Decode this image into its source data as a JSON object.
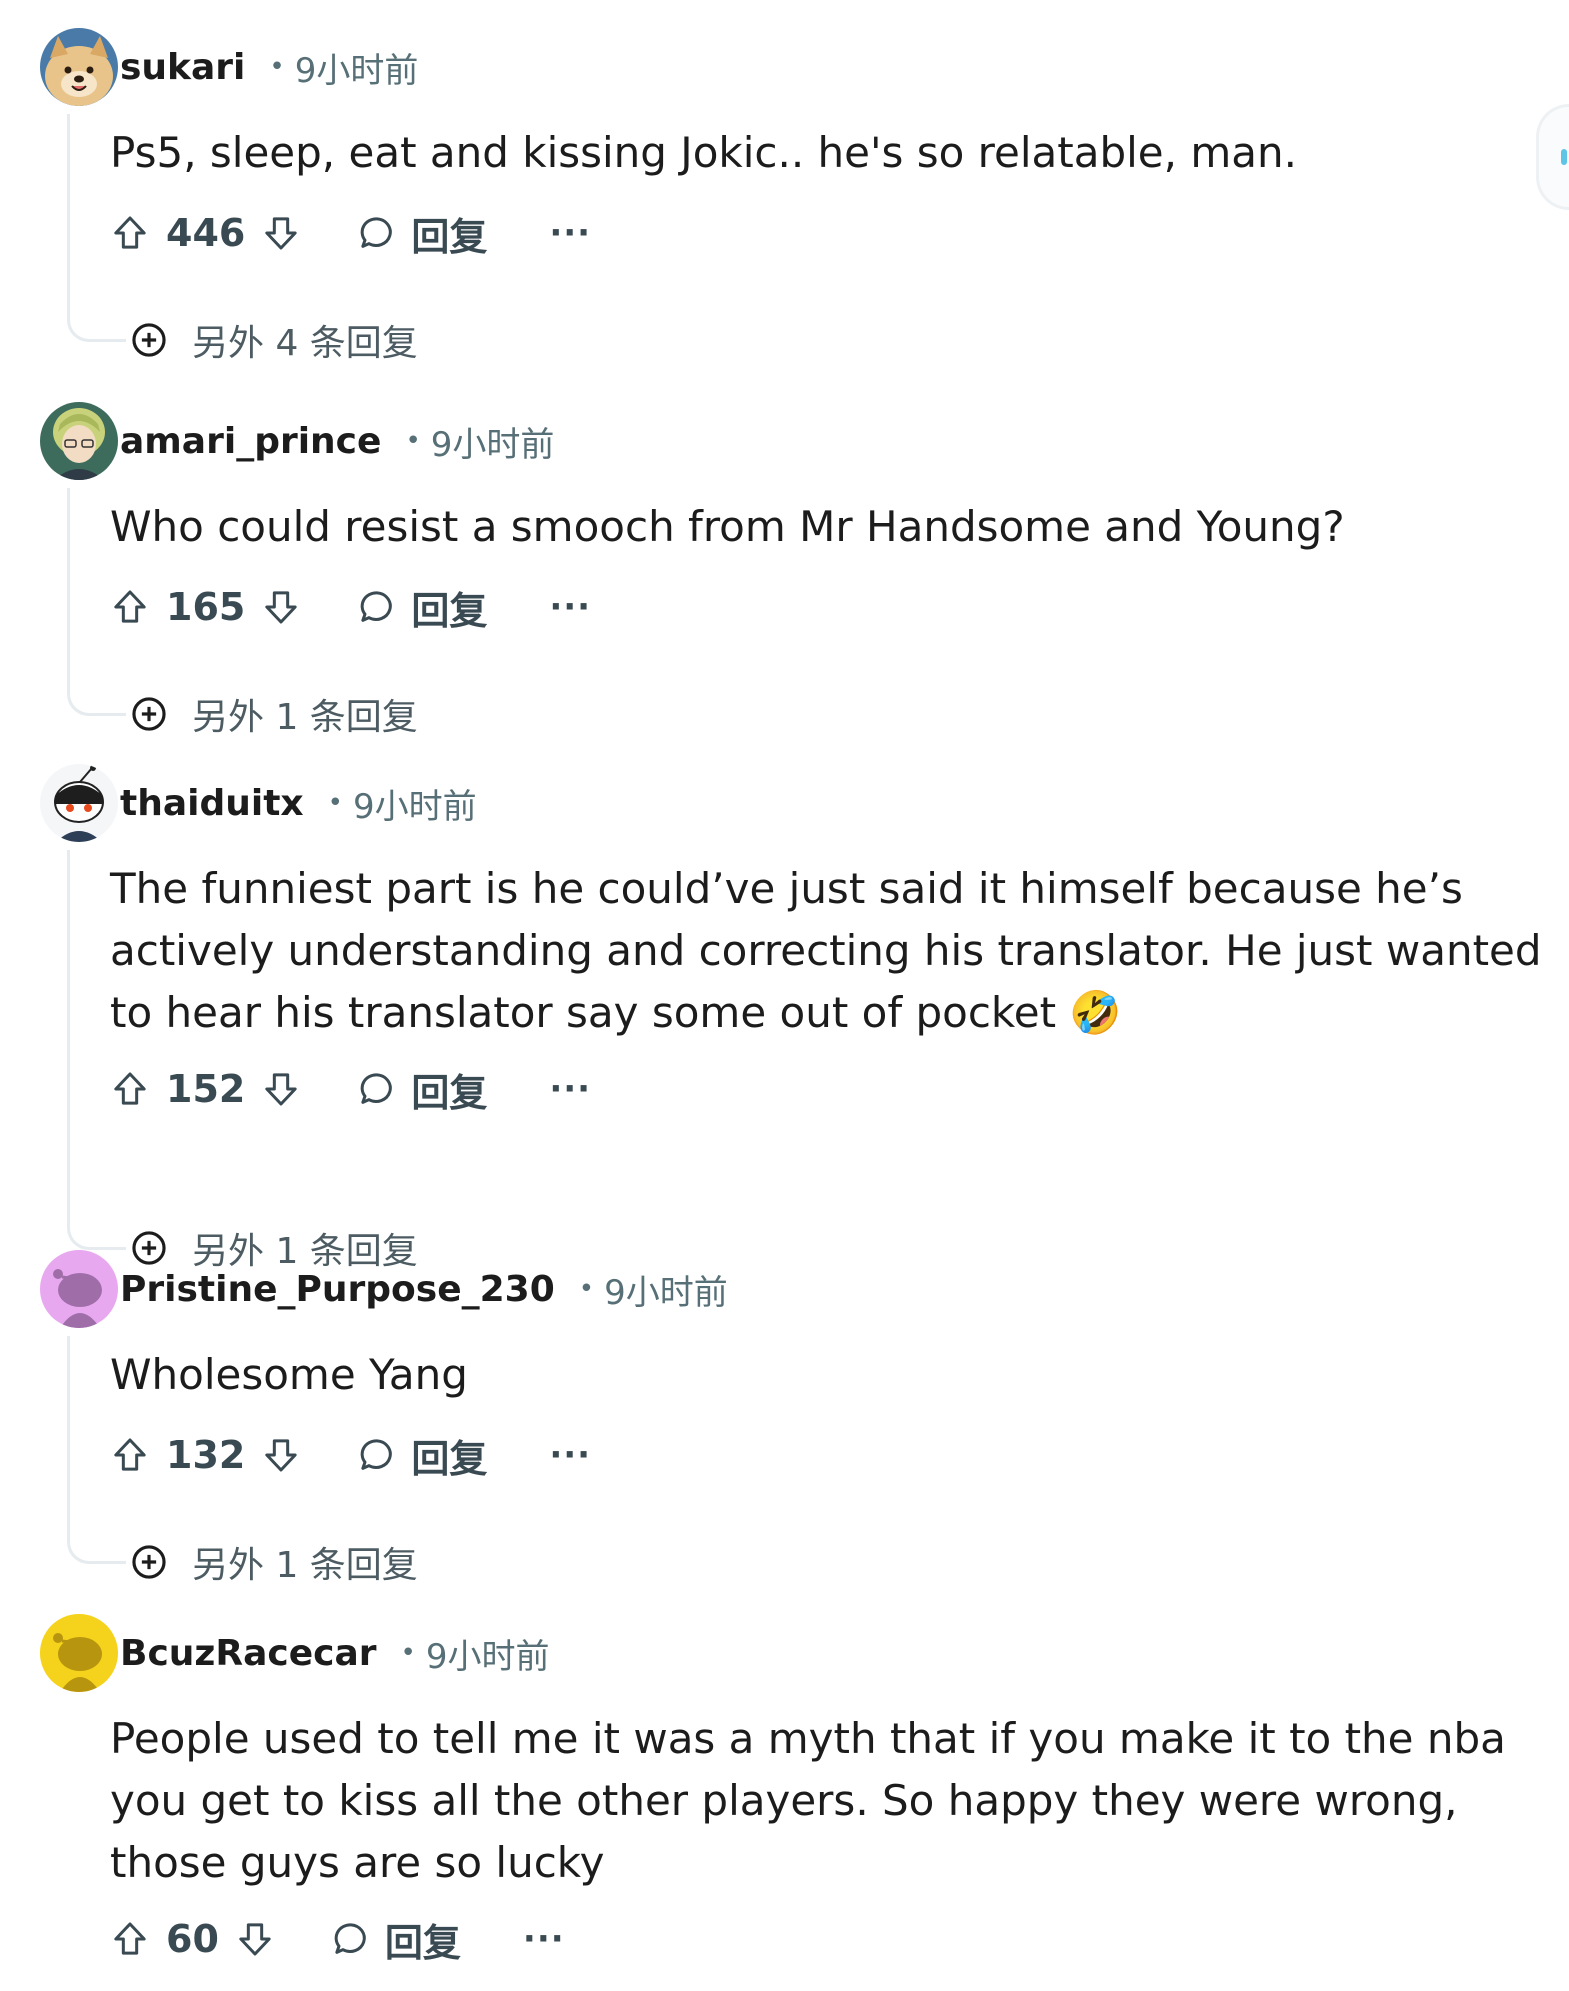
{
  "comments": [
    {
      "username": "sukari",
      "dot": "•",
      "time": "9小时前",
      "body": "Ps5, sleep, eat and kissing Jokic.. he's so relatable, man.",
      "votes": "446",
      "reply_label": "回复",
      "more_label": "···",
      "more_replies": "另外 4 条回复",
      "avatar_icon": "dog-avatar-icon"
    },
    {
      "username": "amari_prince",
      "dot": "•",
      "time": "9小时前",
      "body": "Who could resist a smooch from Mr Handsome and Young?",
      "votes": "165",
      "reply_label": "回复",
      "more_label": "···",
      "more_replies": "另外 1 条回复",
      "avatar_icon": "anime-character-avatar-icon"
    },
    {
      "username": "thaiduitx",
      "dot": "•",
      "time": "9小时前",
      "body": "The funniest part is he could’ve just said it himself because he’s actively understanding and correcting his translator. He just wanted to hear his translator say some out of pocket 🤣",
      "votes": "152",
      "reply_label": "回复",
      "more_label": "···",
      "more_replies": "另外 1 条回复",
      "avatar_icon": "snoo-ninja-avatar-icon"
    },
    {
      "username": "Pristine_Purpose_230",
      "dot": "•",
      "time": "9小时前",
      "body": "Wholesome Yang",
      "votes": "132",
      "reply_label": "回复",
      "more_label": "···",
      "more_replies": "另外 1 条回复",
      "avatar_icon": "default-snoo-avatar-icon"
    },
    {
      "username": "BcuzRacecar",
      "dot": "•",
      "time": "9小时前",
      "body": "People used to tell me it was a myth that if you make it to the nba you get to kiss all the other players. So happy they were wrong, those guys are so lucky",
      "votes": "60",
      "reply_label": "回复",
      "more_label": "···",
      "avatar_icon": "default-snoo-avatar-icon"
    }
  ],
  "colors": {
    "text": "#1c1c1c",
    "meta": "#576f76",
    "action": "#3a4a52",
    "thread_line": "#e5ebee"
  }
}
